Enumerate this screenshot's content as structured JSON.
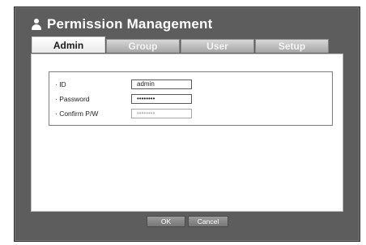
{
  "dialog": {
    "title": "Permission Management",
    "icon": "user-icon"
  },
  "tabs": [
    {
      "label": "Admin",
      "active": true
    },
    {
      "label": "Group",
      "active": false
    },
    {
      "label": "User",
      "active": false
    },
    {
      "label": "Setup",
      "active": false
    }
  ],
  "form": {
    "id_label": "· ID",
    "id_value": "admin",
    "password_label": "· Password",
    "password_value": "••••••••",
    "confirm_label": "· Confirm P/W",
    "confirm_value": "••••••••"
  },
  "buttons": {
    "ok": "OK",
    "cancel": "Cancel"
  }
}
